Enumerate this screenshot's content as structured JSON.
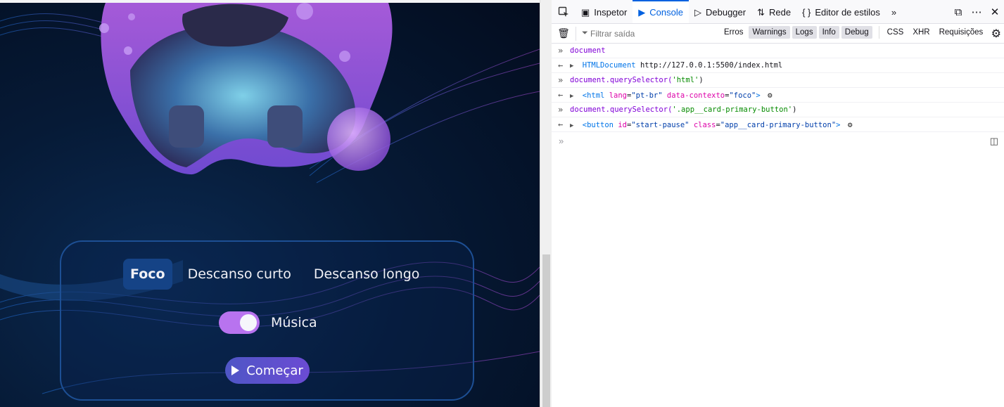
{
  "app": {
    "tabs": [
      {
        "label": "Foco",
        "active": true
      },
      {
        "label": "Descanso curto",
        "active": false
      },
      {
        "label": "Descanso longo",
        "active": false
      }
    ],
    "music_label": "Música",
    "music_on": true,
    "start_button_label": "Começar",
    "colors": {
      "toggle": "#b873ef",
      "active_tab": "#154386",
      "card_border": "#1d4f94",
      "button": "#5a52cc"
    }
  },
  "devtools": {
    "toolbar": {
      "tabs": [
        {
          "label": "Inspetor",
          "icon": "inspector-icon"
        },
        {
          "label": "Console",
          "icon": "console-icon",
          "active": true
        },
        {
          "label": "Debugger",
          "icon": "debugger-icon"
        },
        {
          "label": "Rede",
          "icon": "network-icon"
        },
        {
          "label": "Editor de estilos",
          "icon": "style-editor-icon"
        }
      ]
    },
    "filter": {
      "placeholder": "Filtrar saída",
      "levels": [
        {
          "label": "Erros",
          "on": false
        },
        {
          "label": "Warnings",
          "on": true
        },
        {
          "label": "Logs",
          "on": true
        },
        {
          "label": "Info",
          "on": true
        },
        {
          "label": "Debug",
          "on": true
        }
      ],
      "extra": [
        "CSS",
        "XHR",
        "Requisições"
      ]
    },
    "console": {
      "entries": [
        {
          "input": "document",
          "output_type": "HTMLDocument",
          "output_value": "http://127.0.0.1:5500/index.html"
        },
        {
          "input_fn": "document.querySelector(",
          "input_arg": "'html'",
          "output_tag": "html",
          "output_attrs": [
            [
              "lang",
              "\"pt-br\""
            ],
            [
              "data-contexto",
              "\"foco\""
            ]
          ]
        },
        {
          "input_fn": "document.querySelector(",
          "input_arg": "'.app__card-primary-button'",
          "output_tag": "button",
          "output_attrs": [
            [
              "id",
              "\"start-pause\""
            ],
            [
              "class",
              "\"app__card-primary-button\""
            ]
          ]
        }
      ]
    }
  }
}
